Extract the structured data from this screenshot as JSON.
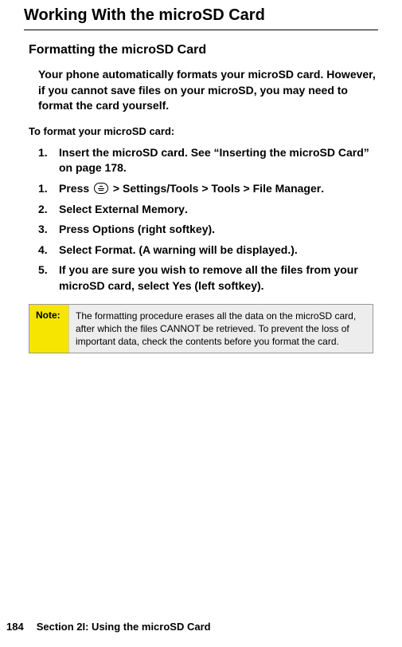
{
  "main_title": "Working With the microSD Card",
  "sub_title": "Formatting the microSD Card",
  "intro": "Your phone automatically formats your microSD card. However, if you cannot save files on your microSD, you may need to format the card yourself.",
  "procedure_heading": "To format your microSD card:",
  "steps": [
    {
      "num": "1.",
      "prefix": "Insert the microSD card. See “Inserting the microSD Card” on page 178.",
      "path": ""
    },
    {
      "num": "1.",
      "prefix": "Press ",
      "icon": true,
      "after_icon": " > ",
      "path": "Settings/Tools > Tools > File Manager",
      "suffix": "."
    },
    {
      "num": "2.",
      "prefix": "Select ",
      "path": "External Memory",
      "suffix": "."
    },
    {
      "num": "3.",
      "prefix": "Press ",
      "path": "Options",
      "suffix": " (right softkey)."
    },
    {
      "num": "4.",
      "prefix": "Select ",
      "path": "Format",
      "suffix": ". (A warning will be displayed.)."
    },
    {
      "num": "5.",
      "prefix": "If you are sure you wish to remove all the files from your microSD card, select ",
      "path": "Yes",
      "suffix": " (left softkey)."
    }
  ],
  "note": {
    "label": "Note:",
    "text": "The formatting procedure erases all the data on the microSD card, after which the files CANNOT be retrieved. To prevent the loss of important data, check the contents before you format the card."
  },
  "footer": {
    "page_num": "184",
    "section": "Section 2I: Using the microSD Card"
  }
}
